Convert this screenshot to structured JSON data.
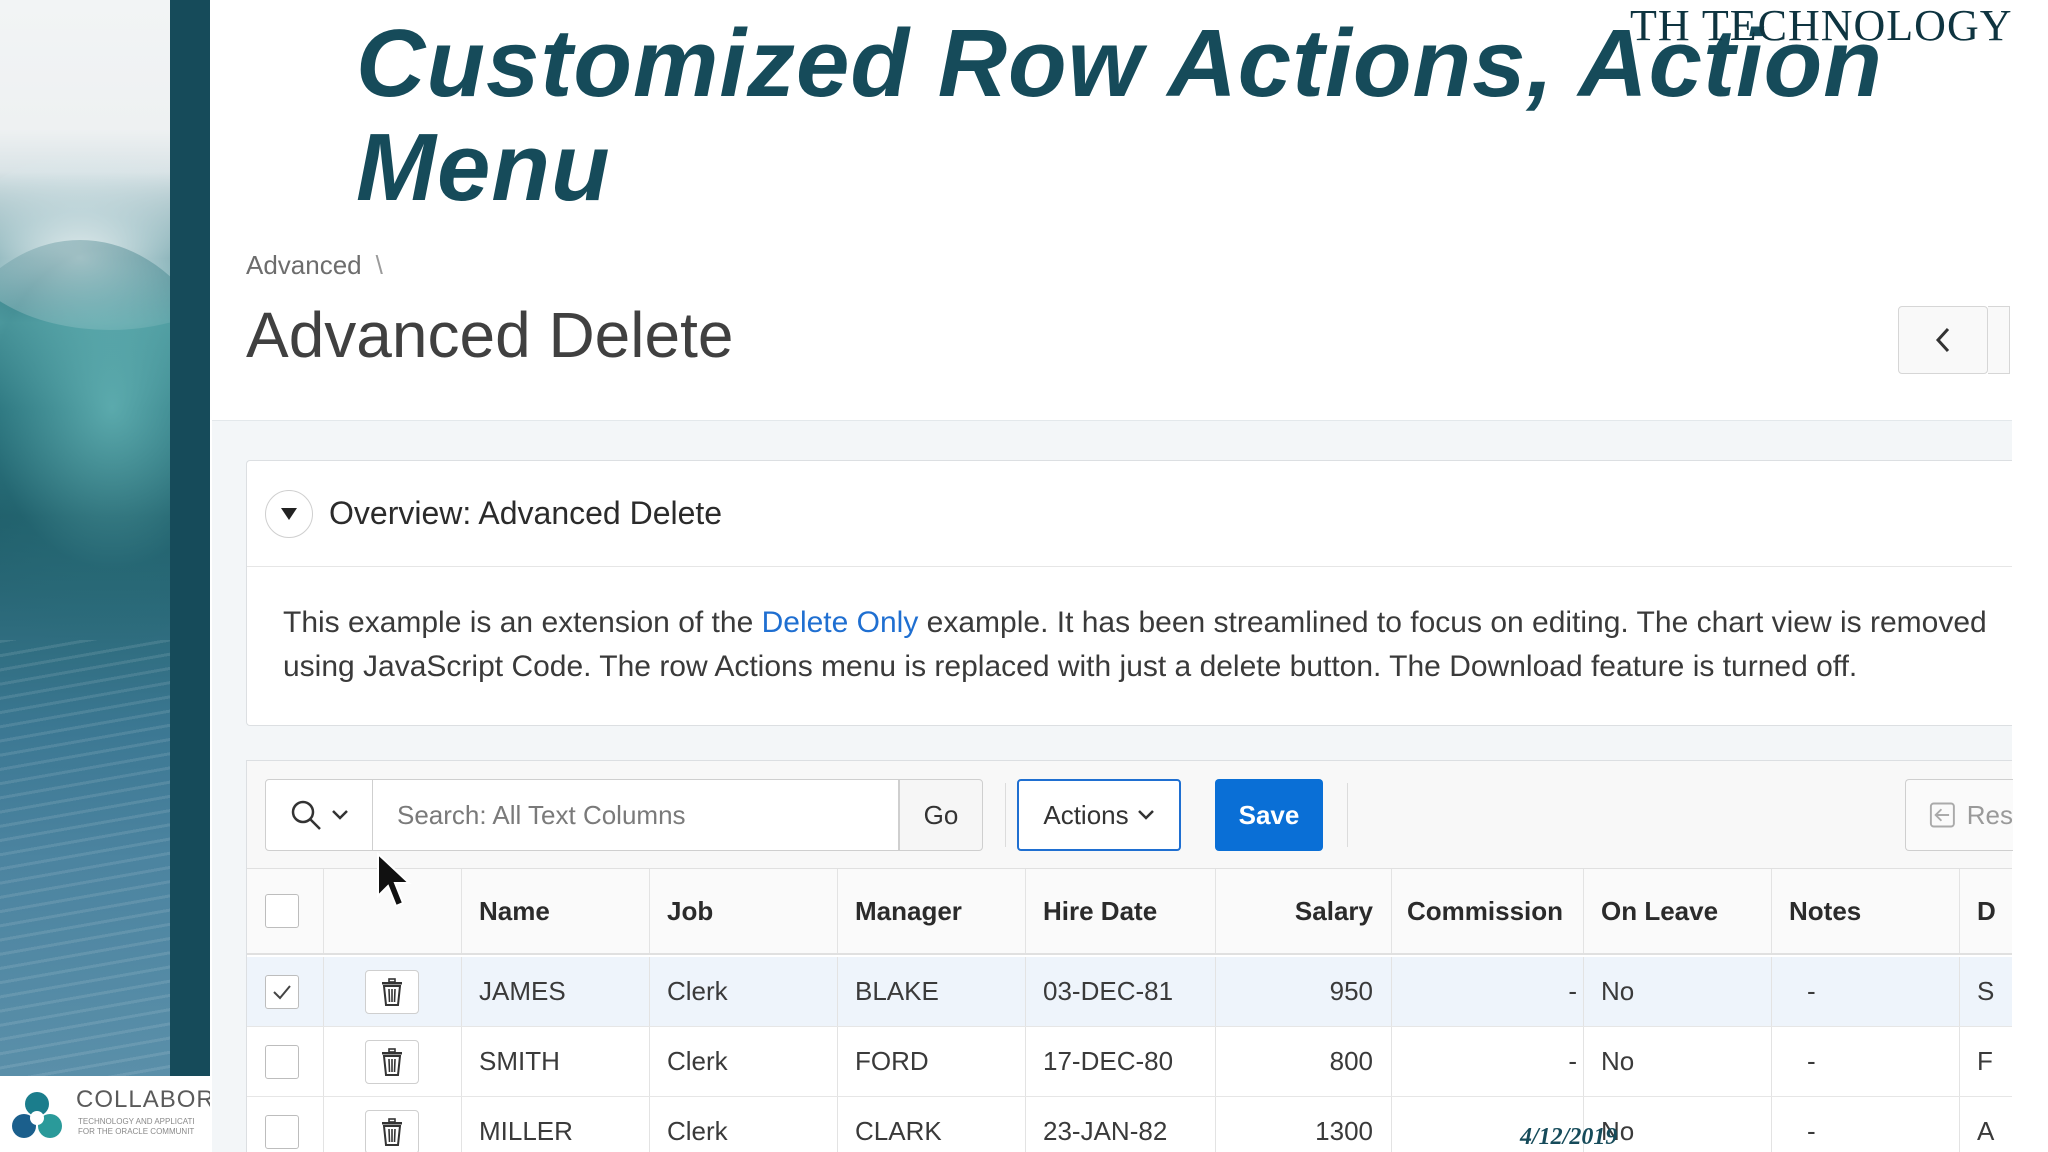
{
  "slide": {
    "title": "Customized Row Actions, Action Menu",
    "brand": "TH TECHNOLOGY",
    "logo_name": "COLLABOR",
    "logo_tagline_1": "TECHNOLOGY AND APPLICATI",
    "logo_tagline_2": "FOR THE ORACLE COMMUNIT",
    "date": "4/12/2019"
  },
  "page": {
    "breadcrumb": "Advanced",
    "breadcrumb_sep": "\\",
    "title": "Advanced Delete"
  },
  "overview": {
    "title": "Overview: Advanced Delete",
    "text_before_link": "This example is an extension of the ",
    "link_text": "Delete Only",
    "text_after_link": " example. It has been streamlined to focus on editing. The chart view is removed using JavaScript Code. The row Actions menu is replaced with just a delete button. The Download feature is turned off."
  },
  "toolbar": {
    "search_placeholder": "Search: All Text Columns",
    "go_label": "Go",
    "actions_label": "Actions",
    "save_label": "Save",
    "reset_label": "Res"
  },
  "grid": {
    "columns": [
      "Name",
      "Job",
      "Manager",
      "Hire Date",
      "Salary",
      "Commission",
      "On Leave",
      "Notes",
      "D"
    ],
    "rows": [
      {
        "selected": true,
        "name": "JAMES",
        "job": "Clerk",
        "manager": "BLAKE",
        "hire_date": "03-DEC-81",
        "salary": "950",
        "commission": "-",
        "on_leave": "No",
        "notes": "-",
        "d": "S"
      },
      {
        "selected": false,
        "name": "SMITH",
        "job": "Clerk",
        "manager": "FORD",
        "hire_date": "17-DEC-80",
        "salary": "800",
        "commission": "-",
        "on_leave": "No",
        "notes": "-",
        "d": "F"
      },
      {
        "selected": false,
        "name": "MILLER",
        "job": "Clerk",
        "manager": "CLARK",
        "hire_date": "23-JAN-82",
        "salary": "1300",
        "commission": "",
        "on_leave": "No",
        "notes": "-",
        "d": "A"
      }
    ]
  },
  "colors": {
    "title": "#164b5a",
    "accent_blue": "#0a6fd6",
    "link": "#1f6fd1"
  },
  "icons": [
    "search-icon",
    "chevron-down-icon",
    "chevron-left-icon",
    "collapse-triangle-icon",
    "trash-icon",
    "checkmark-icon",
    "reset-icon",
    "cursor-arrow-icon",
    "collaborate-logo-icon"
  ]
}
